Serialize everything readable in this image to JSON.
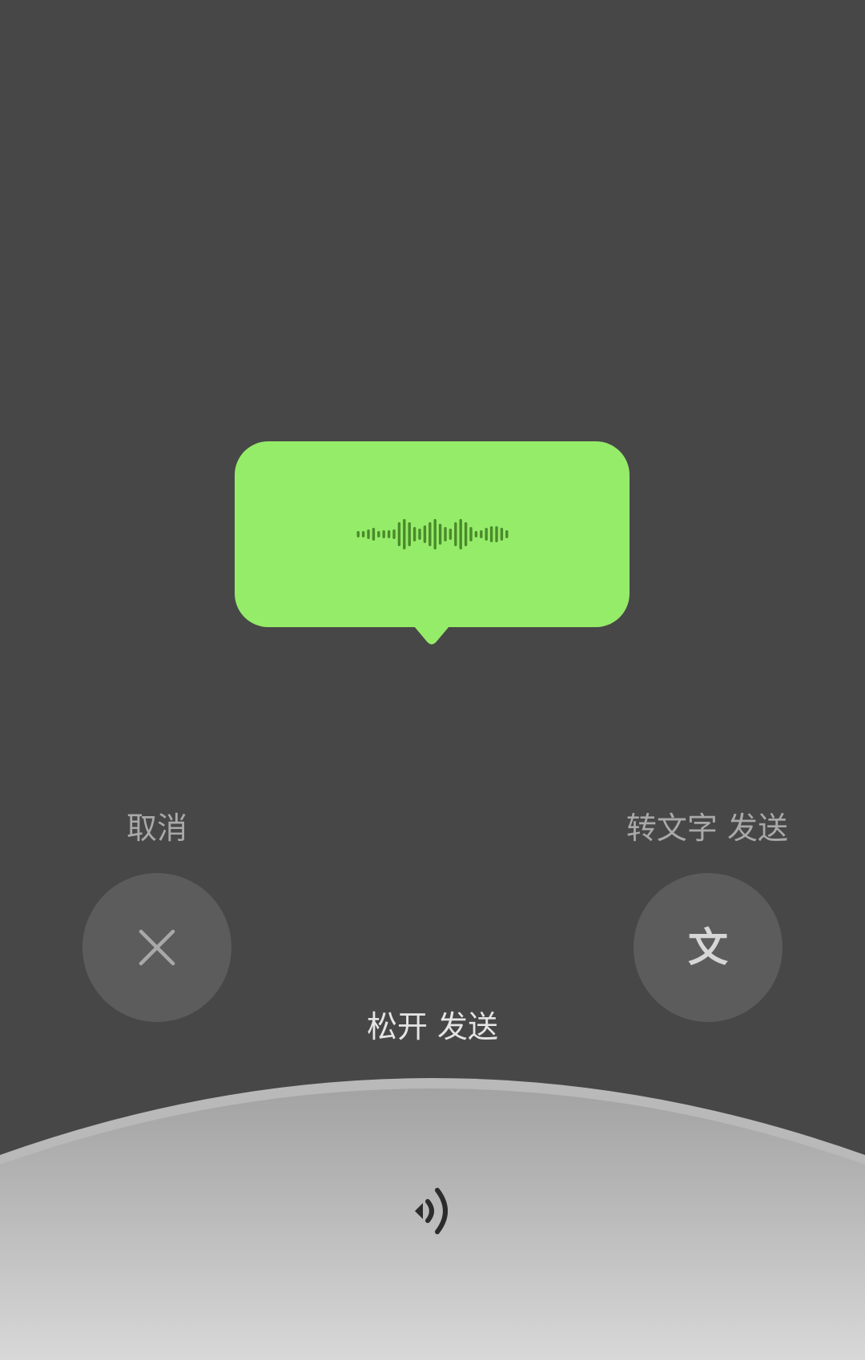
{
  "recording": {
    "bubble_color": "#95ec69",
    "waveform_color": "#4a8a2b",
    "waveform_icon": "audio-waveform-icon"
  },
  "actions": {
    "cancel": {
      "label": "取消",
      "icon": "close-icon"
    },
    "convert": {
      "label": "转文字 发送",
      "icon": "wen-text-icon",
      "glyph": "文"
    }
  },
  "hint": {
    "release_label": "松开 发送"
  },
  "hold_area": {
    "icon": "speaker-icon"
  },
  "colors": {
    "background": "#474747",
    "circle_button": "#5c5c5c",
    "arc_top": "#a3a3a3",
    "arc_bottom": "#d8d8d8"
  }
}
